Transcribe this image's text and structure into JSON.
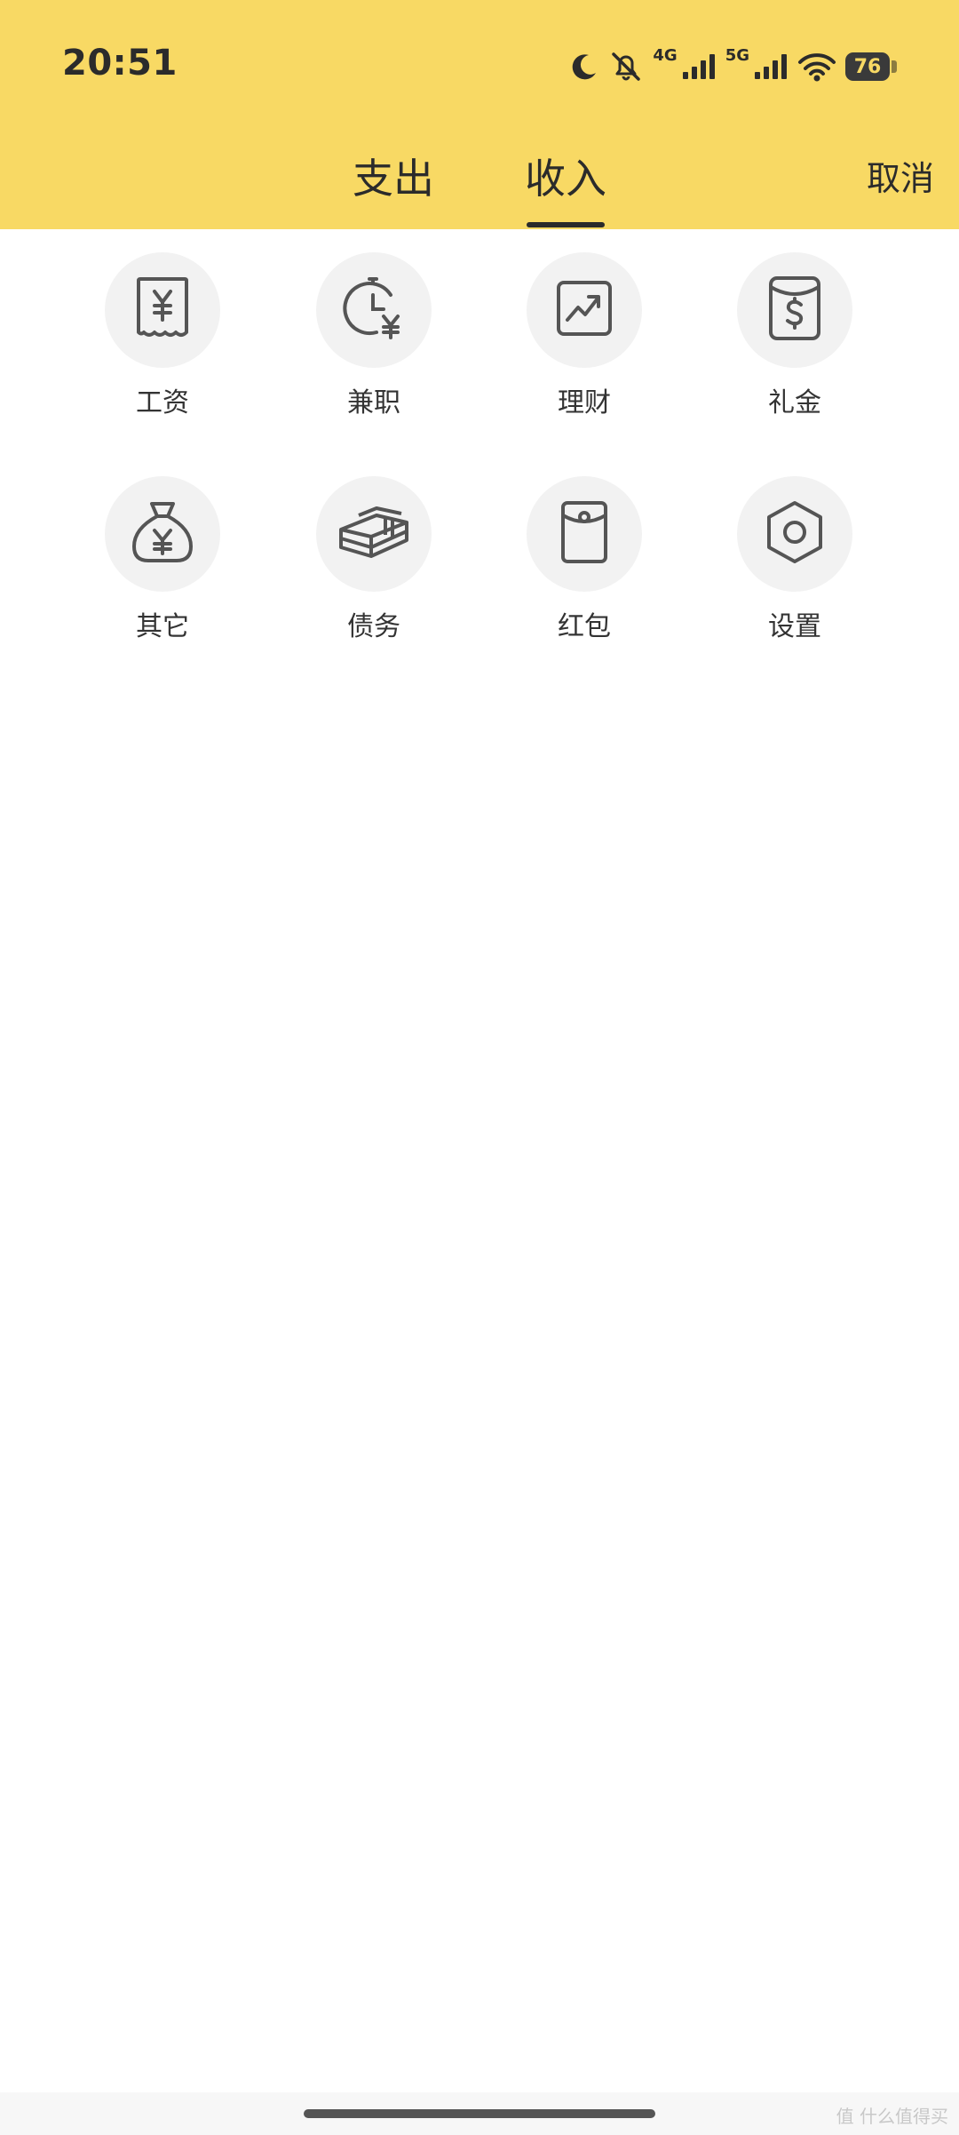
{
  "status_bar": {
    "time": "20:51",
    "network_4g": "4G",
    "network_5g": "5G",
    "battery": "76",
    "icons": [
      "moon-icon",
      "muted-bell-icon",
      "signal-4g-icon",
      "signal-5g-icon",
      "wifi-icon",
      "battery-icon"
    ]
  },
  "tabs": {
    "expense": "支出",
    "income": "收入",
    "active": "income"
  },
  "header": {
    "cancel": "取消"
  },
  "categories": [
    {
      "label": "工资",
      "icon": "salary-receipt-icon"
    },
    {
      "label": "兼职",
      "icon": "part-time-clock-icon"
    },
    {
      "label": "理财",
      "icon": "investment-chart-icon"
    },
    {
      "label": "礼金",
      "icon": "gift-money-icon"
    },
    {
      "label": "其它",
      "icon": "money-bag-icon"
    },
    {
      "label": "债务",
      "icon": "debt-cash-stack-icon"
    },
    {
      "label": "红包",
      "icon": "red-envelope-icon"
    },
    {
      "label": "设置",
      "icon": "settings-hexagon-icon"
    }
  ],
  "watermark": "值 什么值得买",
  "colors": {
    "header_bg": "#F8D964",
    "icon_circle_bg": "#F2F2F2",
    "icon_stroke": "#555555",
    "text": "#333333"
  }
}
